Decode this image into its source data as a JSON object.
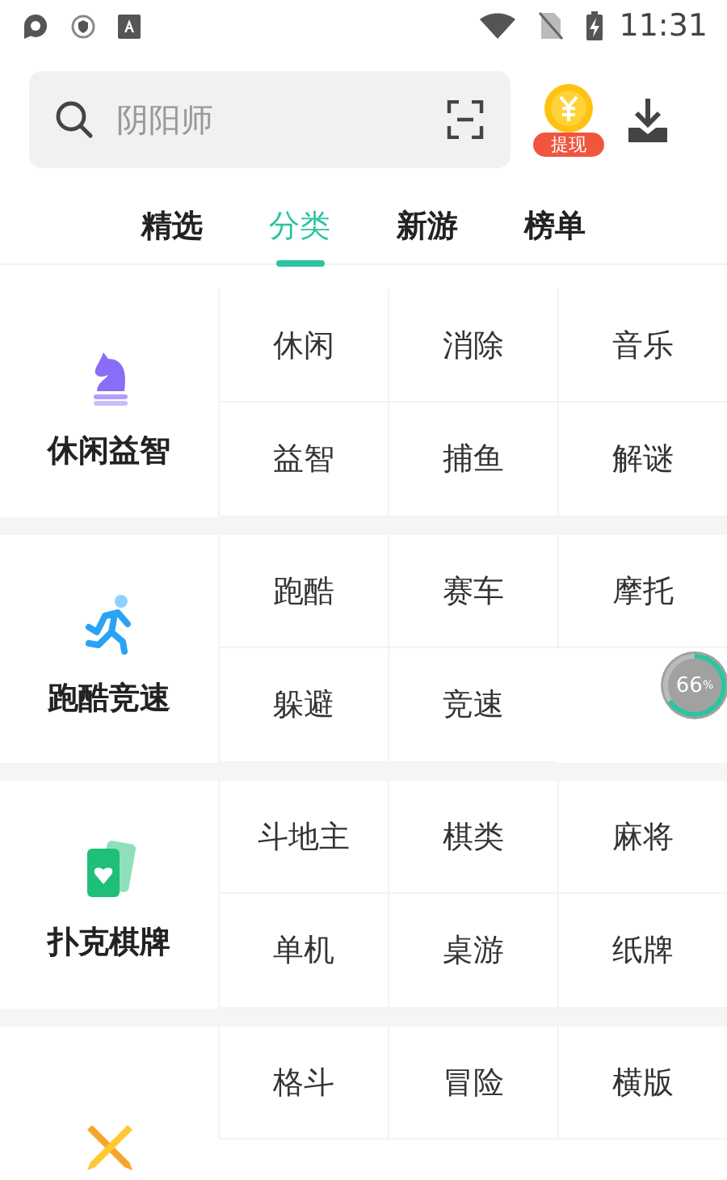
{
  "status_bar": {
    "time": "11:31"
  },
  "search": {
    "placeholder": "阴阳师"
  },
  "coin_badge": "提现",
  "tabs": [
    {
      "label": "精选",
      "selected": false
    },
    {
      "label": "分类",
      "selected": true
    },
    {
      "label": "新游",
      "selected": false
    },
    {
      "label": "榜单",
      "selected": false
    }
  ],
  "categories": [
    {
      "kind": "knight",
      "title": "休闲益智",
      "items": [
        "休闲",
        "消除",
        "音乐",
        "益智",
        "捕鱼",
        "解谜"
      ]
    },
    {
      "kind": "runner",
      "title": "跑酷竞速",
      "items": [
        "跑酷",
        "赛车",
        "摩托",
        "躲避",
        "竞速"
      ]
    },
    {
      "kind": "cards",
      "title": "扑克棋牌",
      "items": [
        "斗地主",
        "棋类",
        "麻将",
        "单机",
        "桌游",
        "纸牌"
      ]
    },
    {
      "kind": "swords",
      "items": [
        "格斗",
        "冒险",
        "横版"
      ]
    }
  ],
  "progress_badge": {
    "level": 0.66,
    "reading": "66",
    "unit": "%"
  }
}
